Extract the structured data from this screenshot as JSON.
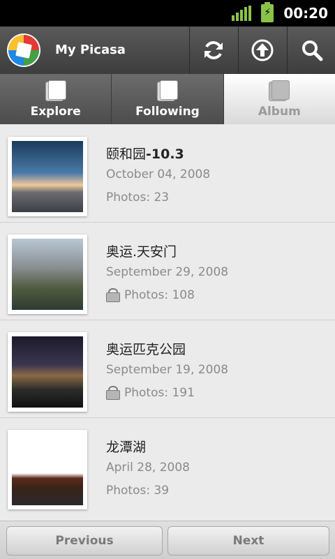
{
  "status": {
    "time": "00:20"
  },
  "titlebar": {
    "app_title": "My Picasa",
    "actions": [
      {
        "icon": "refresh-icon"
      },
      {
        "icon": "upload-icon"
      },
      {
        "icon": "search-icon"
      }
    ]
  },
  "tabs": [
    {
      "label": "Explore",
      "selected": false
    },
    {
      "label": "Following",
      "selected": false
    },
    {
      "label": "Album",
      "selected": true
    }
  ],
  "albums": [
    {
      "name_a": "颐和园",
      "name_b": "-10.3",
      "date": "October 04, 2008",
      "photos": "Photos: 23",
      "locked": false
    },
    {
      "name_a": "奥运.天安门",
      "name_b": "",
      "date": "September 29, 2008",
      "photos": "Photos: 108",
      "locked": true
    },
    {
      "name_a": "奥运匹克公园",
      "name_b": "",
      "date": "September 19, 2008",
      "photos": "Photos: 191",
      "locked": true
    },
    {
      "name_a": "龙潭湖",
      "name_b": "",
      "date": "April 28, 2008",
      "photos": "Photos: 39",
      "locked": false
    }
  ],
  "pagination": {
    "prev": "Previous",
    "next": "Next"
  },
  "colors": {
    "accent_green": "#8bc34a",
    "title_bg": "#4a4a4a",
    "list_bg": "#ebebeb"
  }
}
